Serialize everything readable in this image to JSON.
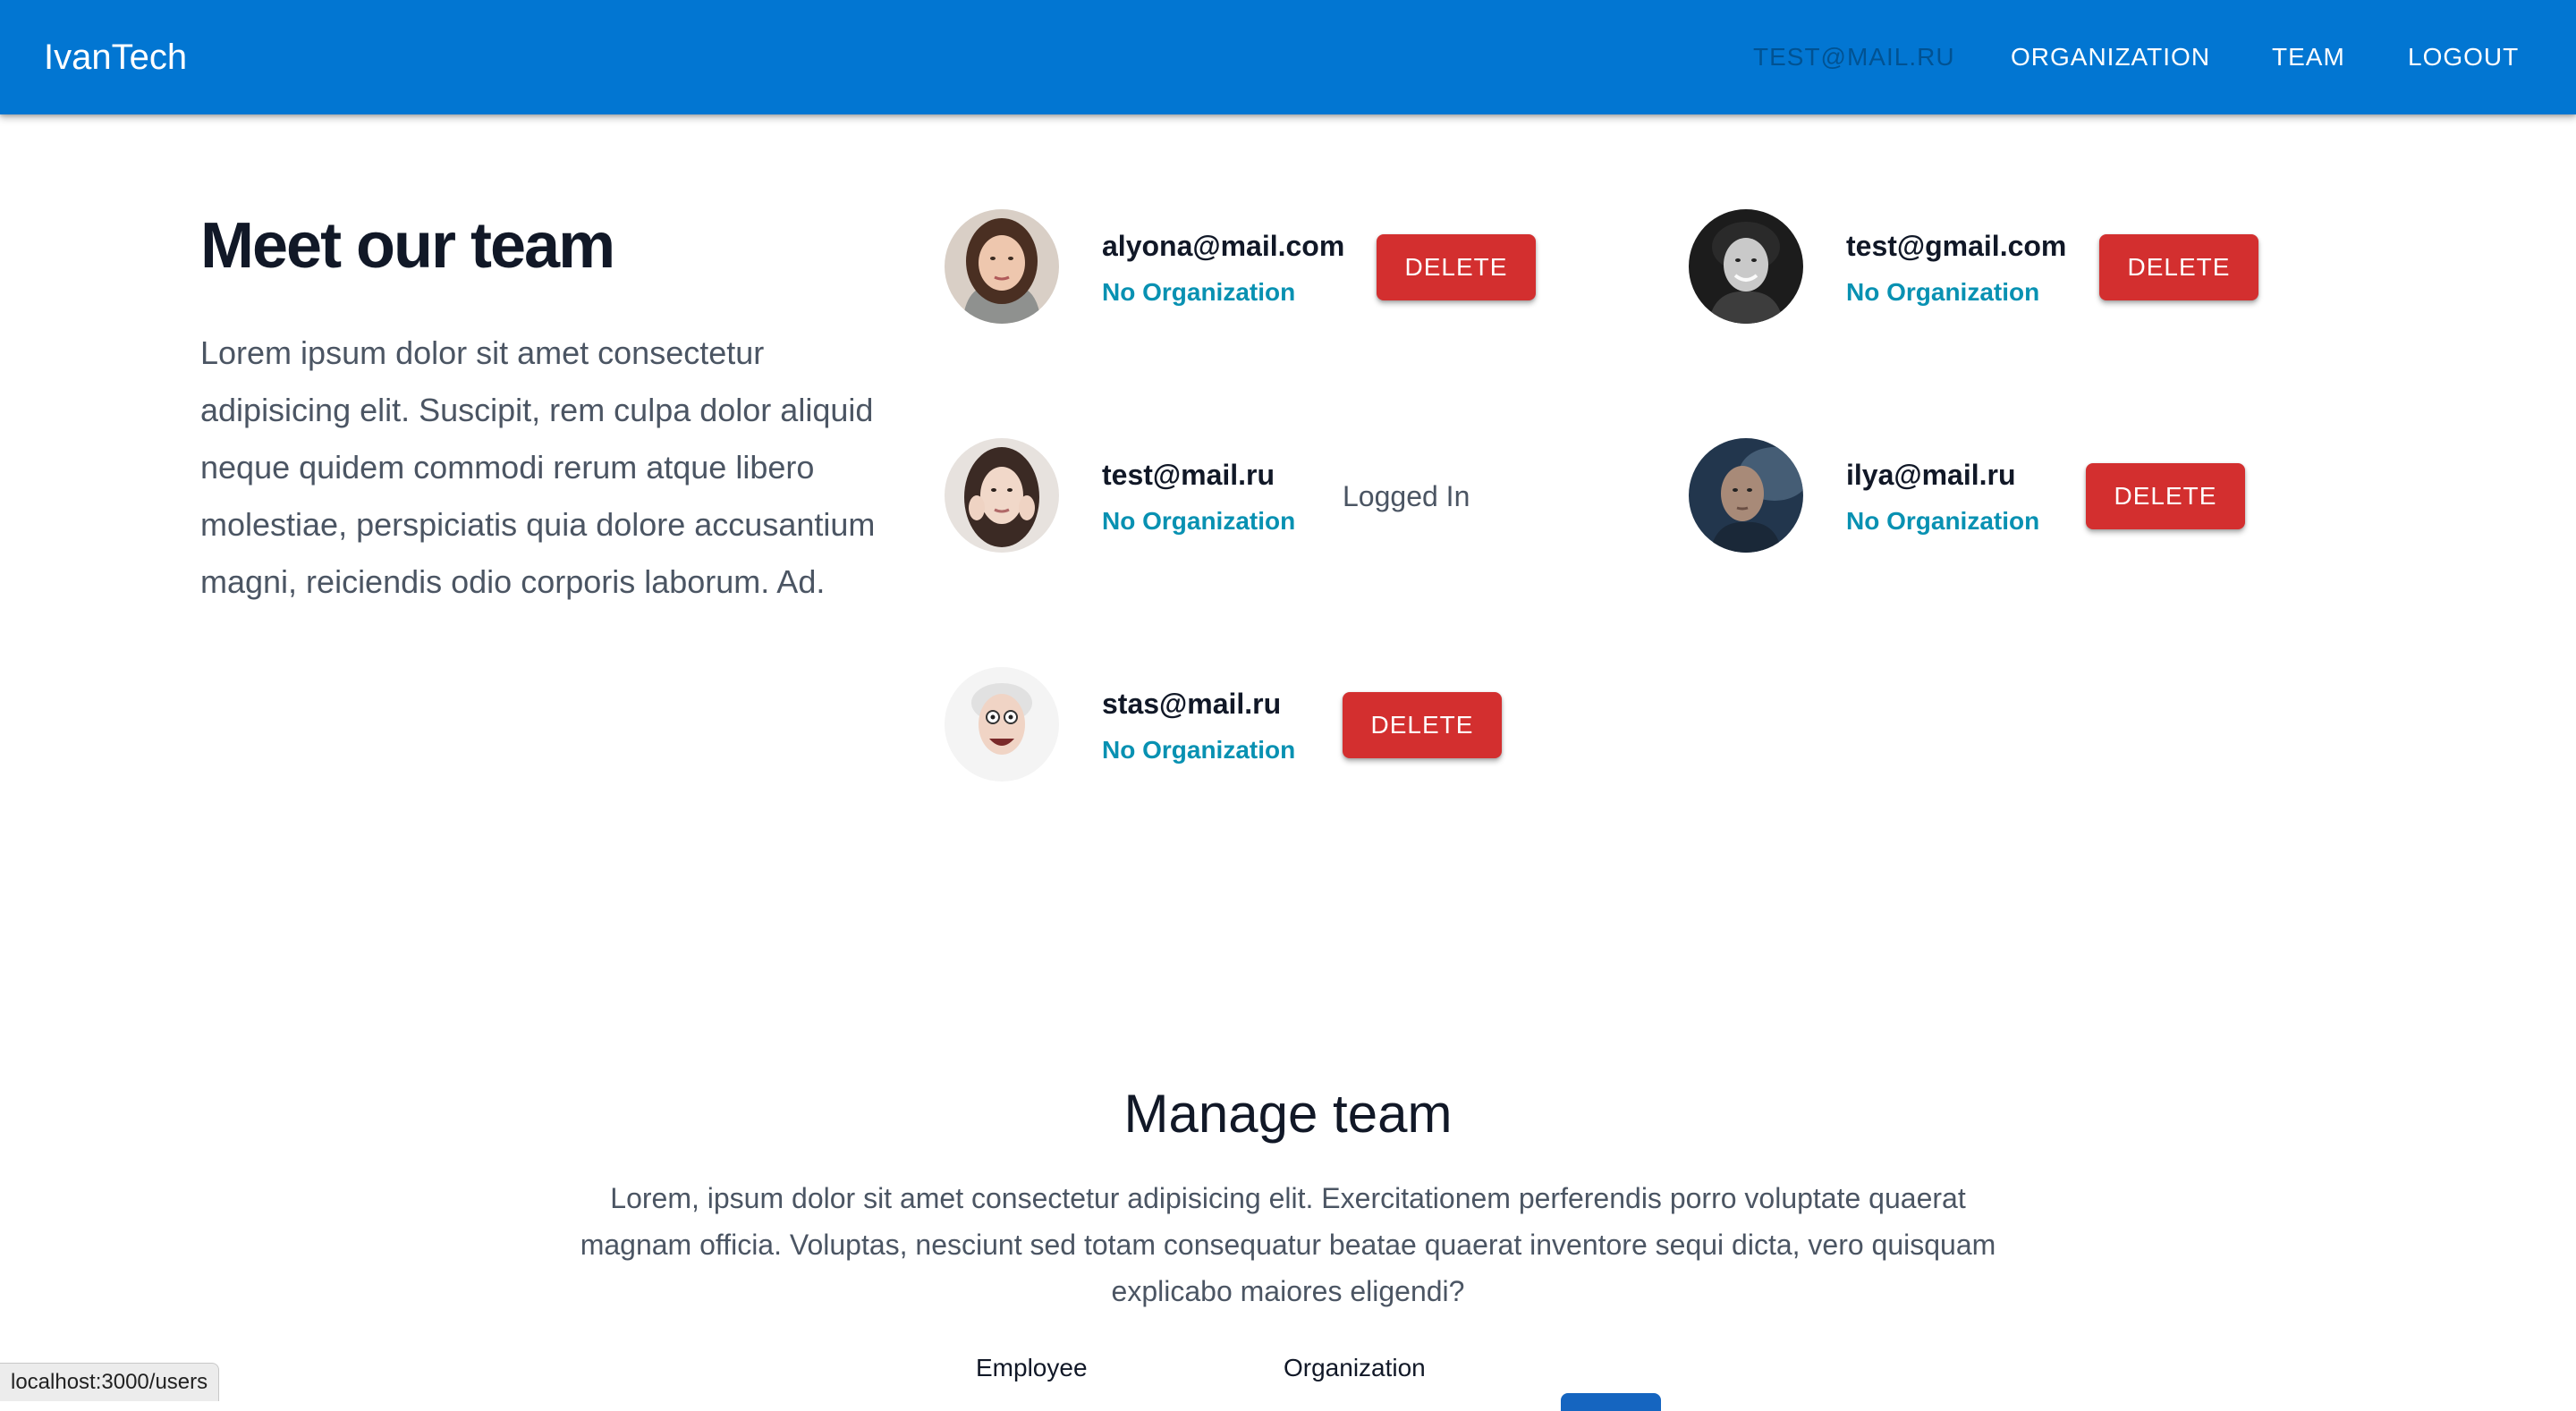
{
  "appbar": {
    "brand": "IvanTech",
    "nav": {
      "user": "TEST@MAIL.RU",
      "organization": "ORGANIZATION",
      "team": "TEAM",
      "logout": "LOGOUT"
    },
    "color": "#0276d2"
  },
  "hero": {
    "title": "Meet our team",
    "text": "Lorem ipsum dolor sit amet consectetur adipisicing elit. Suscipit, rem culpa dolor aliquid neque quidem commodi rerum atque libero molestiae, perspiciatis quia dolore accusantium magni, reiciendis odio corporis laborum. Ad."
  },
  "team": {
    "members": [
      {
        "email": "alyona@mail.com",
        "organization": "No Organization",
        "action": "DELETE"
      },
      {
        "email": "test@gmail.com",
        "organization": "No Organization",
        "action": "DELETE"
      },
      {
        "email": "test@mail.ru",
        "organization": "No Organization",
        "status": "Logged In"
      },
      {
        "email": "ilya@mail.ru",
        "organization": "No Organization",
        "action": "DELETE"
      },
      {
        "email": "stas@mail.ru",
        "organization": "No Organization",
        "action": "DELETE"
      }
    ],
    "delete_color": "#d32f2f",
    "organization_color": "#0891b2"
  },
  "manage": {
    "title": "Manage team",
    "text": "Lorem, ipsum dolor sit amet consectetur adipisicing elit. Exercitationem perferendis porro voluptate quaerat magnam officia. Voluptas, nesciunt sed totam consequatur beatae quaerat inventore sequi dicta, vero quisquam explicabo maiores eligendi?",
    "columns": {
      "employee": "Employee",
      "organization": "Organization"
    }
  },
  "browser": {
    "status_url": "localhost:3000/users"
  }
}
